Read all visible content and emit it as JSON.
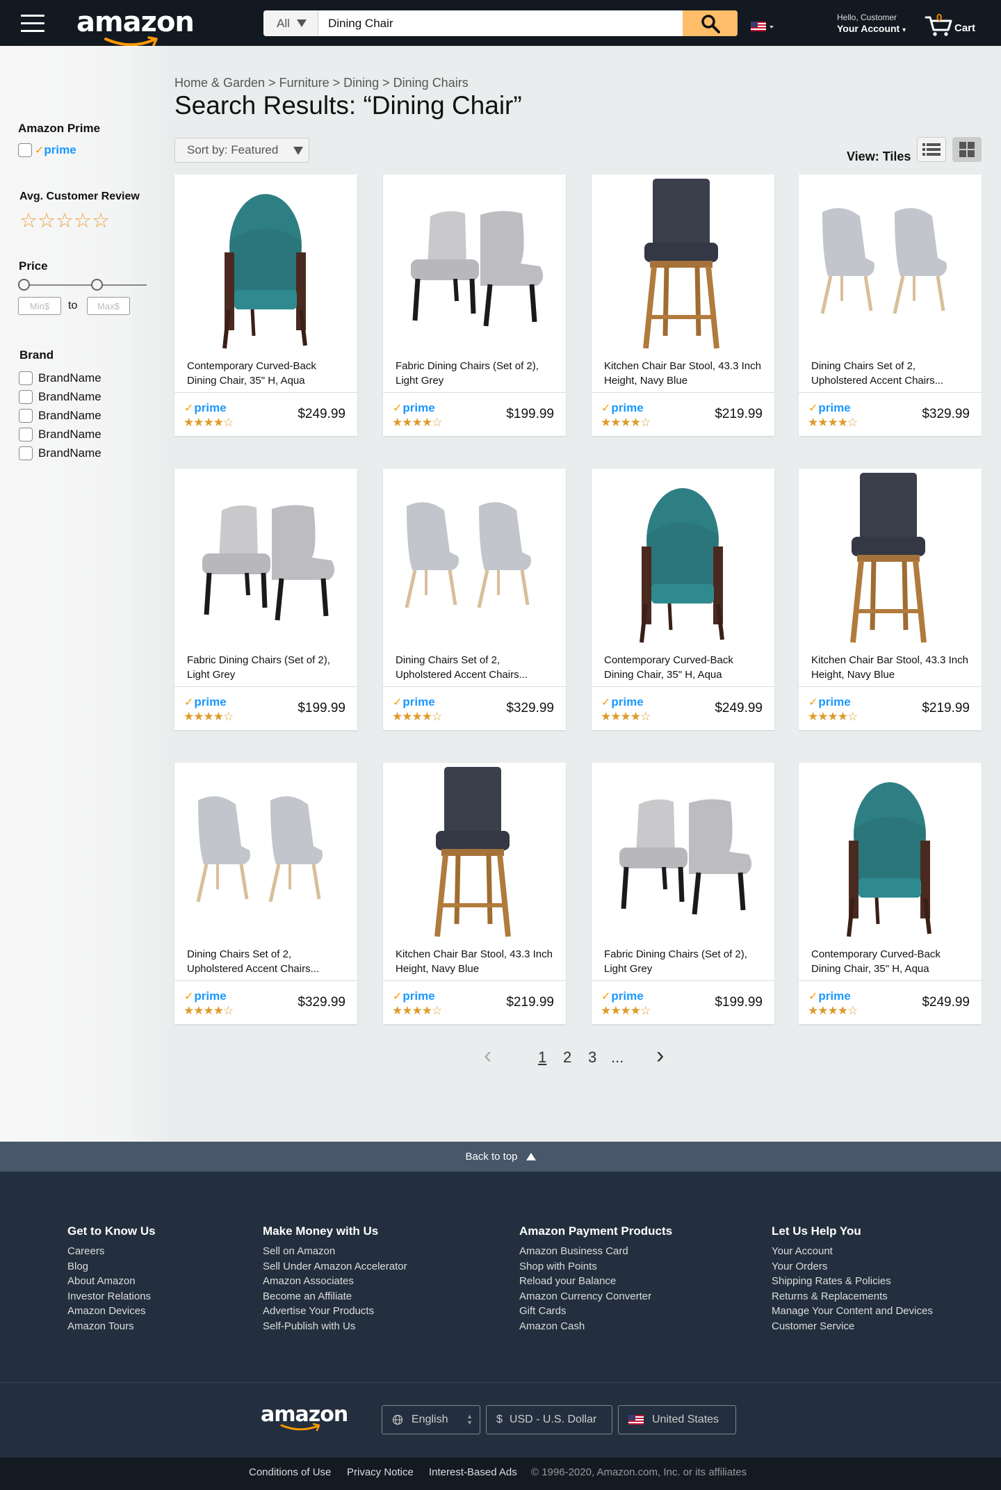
{
  "header": {
    "logo": "amazon",
    "search_category": "All",
    "search_value": "Dining Chair",
    "account_greeting": "Hello, Customer",
    "account_label": "Your Account",
    "cart_count": "0",
    "cart_label": "Cart"
  },
  "sidebar": {
    "prime_heading": "Amazon Prime",
    "prime_label": "prime",
    "review_heading": "Avg. Customer Review",
    "review_stars": "☆☆☆☆☆",
    "price_heading": "Price",
    "price_min_placeholder": "Min$",
    "price_to": "to",
    "price_max_placeholder": "Max$",
    "brand_heading": "Brand",
    "brands": [
      "BrandName",
      "BrandName",
      "BrandName",
      "BrandName",
      "BrandName"
    ]
  },
  "main": {
    "breadcrumb": "Home & Garden > Furniture > Dining > Dining Chairs",
    "title": "Search Results: “Dining Chair”",
    "sort_label": "Sort by: Featured",
    "view_label": "View: Tiles"
  },
  "products": [
    {
      "title": "Contemporary Curved-Back Dining Chair, 35\" H, Aqua",
      "prime": "prime",
      "rating": "★★★★☆",
      "rating_value": 4,
      "price": "$249.99",
      "kind": "aqua"
    },
    {
      "title": "Fabric Dining Chairs (Set of 2), Light Grey",
      "prime": "prime",
      "rating": "★★★★☆",
      "rating_value": 4,
      "price": "$199.99",
      "kind": "grey"
    },
    {
      "title": "Kitchen Chair Bar Stool, 43.3 Inch Height, Navy Blue",
      "prime": "prime",
      "rating": "★★★★☆",
      "rating_value": 4,
      "price": "$219.99",
      "kind": "stool"
    },
    {
      "title": "Dining Chairs Set of 2, Upholstered Accent Chairs...",
      "prime": "prime",
      "rating": "★★★★☆",
      "rating_value": 4,
      "price": "$329.99",
      "kind": "accent"
    },
    {
      "title": "Fabric Dining Chairs (Set of 2), Light Grey",
      "prime": "prime",
      "rating": "★★★★☆",
      "rating_value": 4,
      "price": "$199.99",
      "kind": "grey"
    },
    {
      "title": "Dining Chairs Set of 2, Upholstered Accent Chairs...",
      "prime": "prime",
      "rating": "★★★★☆",
      "rating_value": 4,
      "price": "$329.99",
      "kind": "accent"
    },
    {
      "title": "Contemporary Curved-Back Dining Chair, 35\" H, Aqua",
      "prime": "prime",
      "rating": "★★★★☆",
      "rating_value": 4,
      "price": "$249.99",
      "kind": "aqua"
    },
    {
      "title": "Kitchen Chair Bar Stool, 43.3 Inch Height, Navy Blue",
      "prime": "prime",
      "rating": "★★★★☆",
      "rating_value": 4,
      "price": "$219.99",
      "kind": "stool"
    },
    {
      "title": "Dining Chairs Set of 2, Upholstered Accent Chairs...",
      "prime": "prime",
      "rating": "★★★★☆",
      "rating_value": 4,
      "price": "$329.99",
      "kind": "accent"
    },
    {
      "title": "Kitchen Chair Bar Stool, 43.3 Inch Height, Navy Blue",
      "prime": "prime",
      "rating": "★★★★☆",
      "rating_value": 4,
      "price": "$219.99",
      "kind": "stool"
    },
    {
      "title": "Fabric Dining Chairs (Set of 2), Light Grey",
      "prime": "prime",
      "rating": "★★★★☆",
      "rating_value": 4,
      "price": "$199.99",
      "kind": "grey"
    },
    {
      "title": "Contemporary Curved-Back Dining Chair, 35\" H, Aqua",
      "prime": "prime",
      "rating": "★★★★☆",
      "rating_value": 4,
      "price": "$249.99",
      "kind": "aqua"
    }
  ],
  "pagination": {
    "prev": "‹",
    "pages": [
      "1",
      "2",
      "3"
    ],
    "ellipsis": "...",
    "next": "›",
    "current": "1"
  },
  "footer": {
    "back_to_top": "Back to top",
    "columns": [
      {
        "heading": "Get to Know Us",
        "links": [
          "Careers",
          "Blog",
          "About Amazon",
          "Investor Relations",
          "Amazon Devices",
          "Amazon Tours"
        ]
      },
      {
        "heading": "Make Money with Us",
        "links": [
          "Sell on Amazon",
          "Sell Under Amazon Accelerator",
          "Amazon Associates",
          "Become an Affiliate",
          "Advertise Your Products",
          "Self-Publish with Us"
        ]
      },
      {
        "heading": "Amazon Payment Products",
        "links": [
          "Amazon Business Card",
          "Shop with Points",
          "Reload your Balance",
          "Amazon Currency Converter",
          "Gift Cards",
          "Amazon Cash"
        ]
      },
      {
        "heading": "Let Us Help You",
        "links": [
          "Your Account",
          "Your Orders",
          "Shipping Rates & Policies",
          "Returns & Replacements",
          "Manage Your Content and Devices",
          "Customer Service"
        ]
      }
    ],
    "logo": "amazon",
    "language": "English",
    "currency": "USD - U.S. Dollar",
    "currency_symbol": "$",
    "country": "United States",
    "bottom_links": [
      "Conditions of Use",
      "Privacy Notice",
      "Interest-Based Ads"
    ],
    "copyright": "© 1996-2020, Amazon.com, Inc. or its affiliates"
  },
  "colors": {
    "header_bg": "#131921",
    "search_button": "#febd69",
    "prime_blue": "#1a98ff",
    "star_gold": "#de9b2b",
    "footer_bg": "#232f3e",
    "back_to_top_bg": "#485769"
  },
  "icons": [
    "menu-icon",
    "search-icon",
    "us-flag-icon",
    "cart-icon",
    "list-view-icon",
    "grid-view-icon",
    "globe-icon"
  ]
}
